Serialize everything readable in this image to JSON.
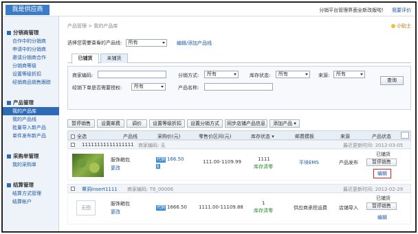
{
  "top": {
    "logo": "我是供应商",
    "notice": "分销平台管理界面全新改版啦!",
    "review": "我要评价"
  },
  "sidebar": [
    {
      "title": "分销商管理",
      "items": [
        "合作中的分销商",
        "申请中的分销商",
        "邀请分销商合作",
        "分销商等级",
        "设置等级折扣",
        "经销商品销售跟踪"
      ]
    },
    {
      "title": "产品管理",
      "items": [
        "我的产品库",
        "我的产品线",
        "批量导入新产品",
        "单件发布新产品"
      ],
      "active": 0
    },
    {
      "title": "采购单管理",
      "items": [
        "我的采购单"
      ]
    },
    {
      "title": "结算管理",
      "items": [
        "结算方式管理",
        "结算帐户"
      ]
    }
  ],
  "main": {
    "breadcrumb": "产品管理 > 我的产品库",
    "helper": "小贴士",
    "line_prompt": "选择您需要查看的产品线:",
    "line_value": "所有",
    "line_edit": "编辑/添加产品线",
    "tabs": [
      "已铺货",
      "未铺货"
    ],
    "filters": {
      "merchant_code": "商家编码:",
      "dist_method": "分销方式:",
      "dist_value": "所有",
      "stock": "库存状态:",
      "stock_value": "所有",
      "source": "来源:",
      "source_value": "所有",
      "auth": "经销下单是否需要授权:",
      "auth_value": "所有",
      "name": "产品名称:",
      "query": "查询"
    },
    "toolbar": [
      "暂停销售",
      "设置邮费",
      "调价",
      "设置等级折扣",
      "设置分销方式",
      "同步店铺产品信息",
      "添加产品 ▾"
    ],
    "headers": {
      "all": "全选",
      "product_line": "产品线",
      "purchase_price": "采购价(元)",
      "retail_range": "零售价区间(元)",
      "stock": "库存状态 ▾",
      "postage": "邮费模板",
      "source": "来源",
      "status": "产品状态"
    },
    "groups": [
      {
        "name": "11111111111111111",
        "code_label": "商家编码: 无",
        "updated": "最近更新时间: 2012-03-05",
        "item": {
          "name": "服饰箱包",
          "change": "更改",
          "badge": "代销",
          "price": "166.50",
          "retail": "111.00-1109.99",
          "stock_num": "1111",
          "stock_state": "库存清零",
          "postage": "平块EMS",
          "source": "产品发布",
          "status": "已铺货",
          "btn_pause": "暂停销售",
          "edit": "编辑"
        }
      },
      {
        "name": "覃洞insert1111",
        "code_label": "商家编码: T8_00006",
        "updated": "最近更新时间: 2012-02-29",
        "item": {
          "noimg": "无图",
          "name": "服饰箱包",
          "change": "更改",
          "badge": "代销",
          "price": "1666.50",
          "retail": "1111.00-11109.88",
          "stock_num": "1",
          "stock_state": "库存清零",
          "postage": "供应商承担运费",
          "source": "店铺导入",
          "status": "已铺货",
          "btn_pause": "暂停销售",
          "edit": "编辑"
        }
      }
    ]
  }
}
